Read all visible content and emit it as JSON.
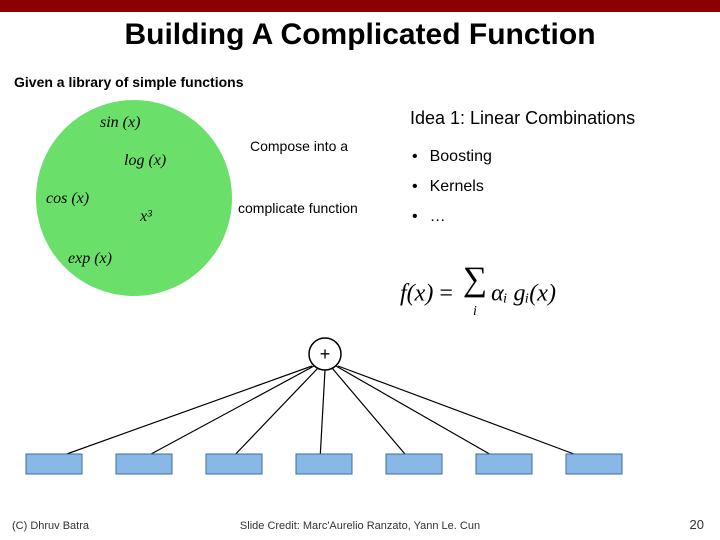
{
  "header": {
    "title": "Building A Complicated Function"
  },
  "subtitle": "Given a library of simple functions",
  "circle": {
    "sin": "sin (x)",
    "log": "log (x)",
    "cos": "cos (x)",
    "cube": "x³",
    "exp": "exp (x)"
  },
  "compose": {
    "line1": "Compose into a",
    "line2": "complicate function"
  },
  "idea": {
    "title": "Idea 1: Linear Combinations",
    "bullets": [
      "Boosting",
      "Kernels",
      "…"
    ]
  },
  "equation": {
    "lhs": "f(x)",
    "eq": " = ",
    "sum": "∑",
    "idx": "i",
    "term": "αᵢ gᵢ(x)"
  },
  "chart_data": {
    "type": "diagram",
    "title": "Linear combination network",
    "node_op": "+",
    "inputs": 7,
    "input_color": "#8ab8e6",
    "edge_color": "#000000"
  },
  "footer": {
    "left": "(C) Dhruv Batra",
    "center": "Slide Credit: Marc'Aurelio Ranzato, Yann Le. Cun",
    "right": "20"
  }
}
